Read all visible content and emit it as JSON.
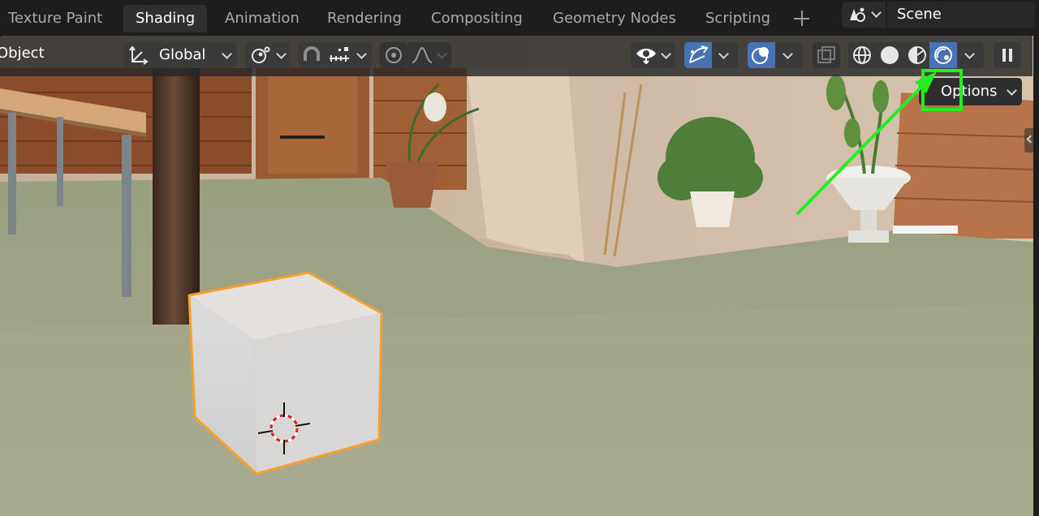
{
  "workspace_tabs": [
    {
      "label": "Texture Paint",
      "active": false
    },
    {
      "label": "Shading",
      "active": true
    },
    {
      "label": "Animation",
      "active": false
    },
    {
      "label": "Rendering",
      "active": false
    },
    {
      "label": "Compositing",
      "active": false
    },
    {
      "label": "Geometry Nodes",
      "active": false
    },
    {
      "label": "Scripting",
      "active": false
    }
  ],
  "scene": {
    "name": "Scene"
  },
  "viewport": {
    "mode_label": "Object",
    "orientation_label": "Global",
    "options_label": "Options",
    "active_shading": "rendered",
    "icons": {
      "orientation": "transform-orientation-icon",
      "pivot": "pivot-point-icon",
      "snap": "snap-magnet-icon",
      "snap_increment": "snap-increment-icon",
      "proportional": "proportional-edit-icon",
      "falloff": "falloff-curve-icon",
      "visibility": "visibility-eye-icon",
      "gizmo": "gizmo-icon",
      "overlays": "overlays-icon",
      "xray": "xray-icon",
      "wireframe": "wireframe-shading-icon",
      "solid": "solid-shading-icon",
      "material": "material-preview-icon",
      "rendered": "rendered-shading-icon",
      "pause": "pause-render-icon"
    }
  },
  "colors": {
    "active_button": "#4772b3",
    "selection_outline": "#f5a030",
    "annotation": "#22ee22"
  }
}
